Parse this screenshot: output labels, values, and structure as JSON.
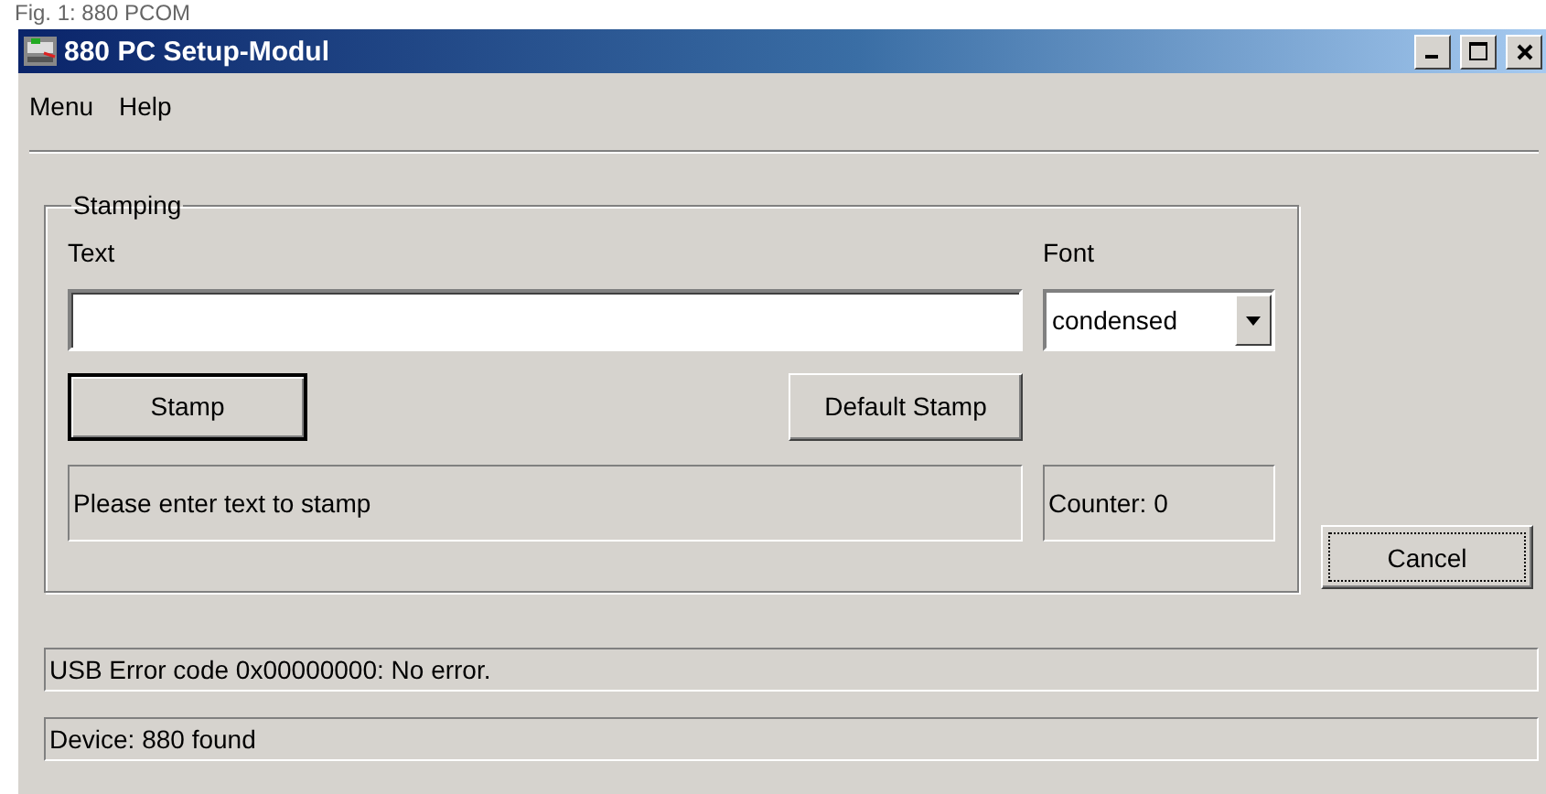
{
  "caption": "Fig. 1: 880 PCOM",
  "window": {
    "title": "880 PC Setup-Modul"
  },
  "menu": [
    "Menu",
    "Help"
  ],
  "stamping": {
    "title": "Stamping",
    "text_label": "Text",
    "font_label": "Font",
    "font_value": "condensed",
    "stamp_button": {
      "label": "Stamp",
      "default": true
    },
    "default_stamp_button": {
      "label": "Default Stamp",
      "default": false
    },
    "message": "Please enter text to stamp",
    "counter": "Counter: 0"
  },
  "cancel_button": {
    "label": "Cancel",
    "focused": true
  },
  "status_lines": [
    "USB Error code 0x00000000: No error.",
    "Device: 880 found"
  ]
}
